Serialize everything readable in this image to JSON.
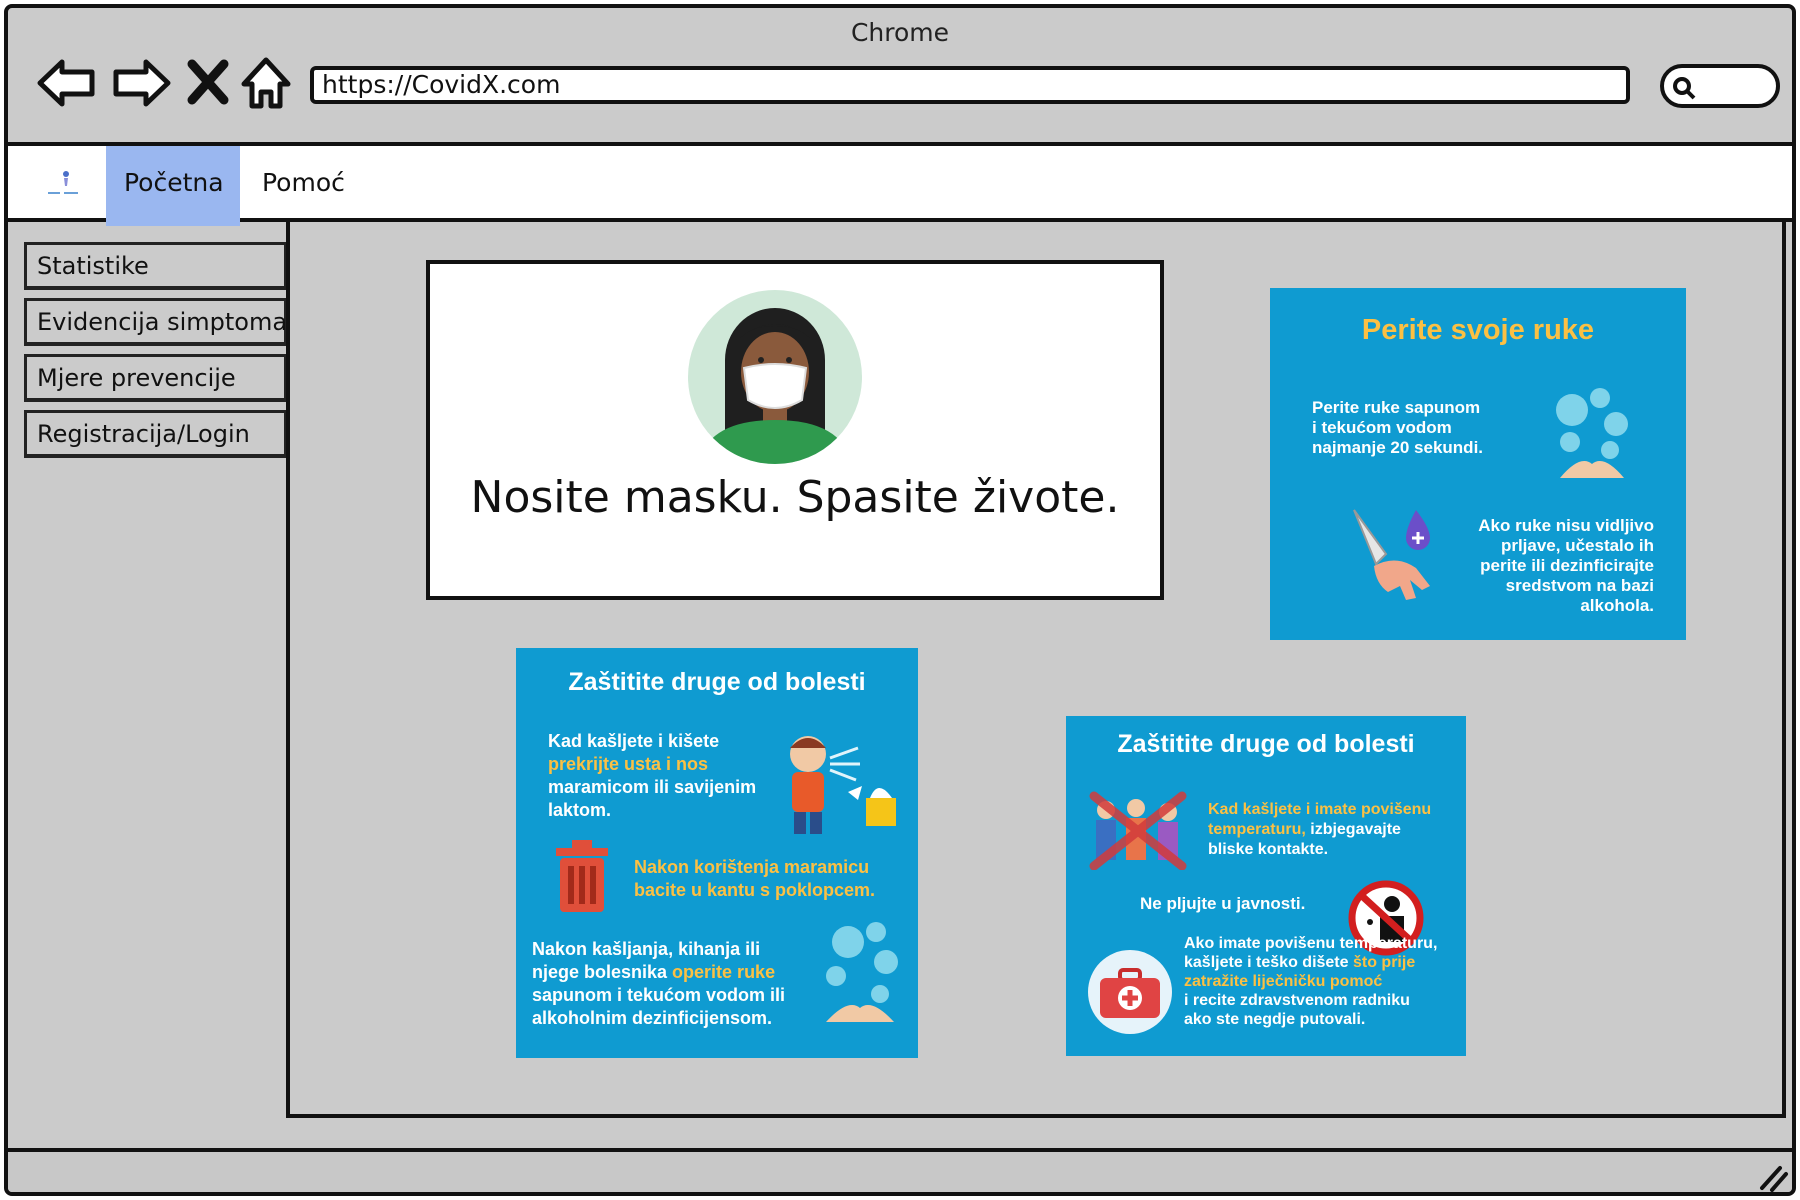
{
  "browser": {
    "title": "Chrome",
    "url": "https://CovidX.com"
  },
  "topnav": {
    "tabs": [
      {
        "label": "Početna",
        "active": true
      },
      {
        "label": "Pomoć",
        "active": false
      }
    ]
  },
  "sidebar": {
    "items": [
      {
        "label": "Statistike"
      },
      {
        "label": "Evidencija simptoma"
      },
      {
        "label": "Mjere prevencije"
      },
      {
        "label": "Registracija/Login"
      }
    ]
  },
  "mask_card": {
    "caption": "Nosite masku. Spasite živote."
  },
  "wash_card": {
    "title": "Perite svoje ruke",
    "text1": "Perite ruke sapunom\ni tekućom vodom\nnajmanje 20 sekundi.",
    "text2": "Ako ruke nisu vidljivo\nprljave, učestalo ih\nperite ili dezinficirajte\nsredstvom na bazi\nalkohola."
  },
  "protect_card_1": {
    "title": "Zaštitite druge od bolesti",
    "p1_a": "Kad kašljete i kišete",
    "p1_b": "prekrijte usta i nos",
    "p1_c": "maramicom ili savijenim\nlaktom.",
    "p2": "Nakon korištenja maramicu\nbacite u kantu s poklopcem.",
    "p3_a": "Nakon kašljanja, kihanja ili\nnjege bolesnika ",
    "p3_b": "operite ruke",
    "p3_c": "\nsapunom i tekućom vodom ili\nalkoholnim dezinficijensom."
  },
  "protect_card_2": {
    "title": "Zaštitite druge od bolesti",
    "p1_a": "Kad kašljete i imate povišenu\ntemperaturu,",
    "p1_b": " izbjegavajte\nbliske kontakte.",
    "p2": "Ne pljujte u javnosti.",
    "p3_a": "Ako imate povišenu temperaturu,\nkašljete i teško dišete ",
    "p3_b": "što prije\nzatražite liječničku pomoć",
    "p3_c": "\ni recite zdravstvenom radniku\nako ste negdje putovali."
  },
  "colors": {
    "active_tab": "#9ab7f0",
    "poster_blue": "#0f9bd1",
    "poster_yellow": "#fcc043",
    "chrome_gray": "#cbcbcb"
  },
  "icons": [
    "back-arrow-icon",
    "forward-arrow-icon",
    "close-icon",
    "home-icon",
    "search-icon",
    "resize-handle-icon"
  ]
}
